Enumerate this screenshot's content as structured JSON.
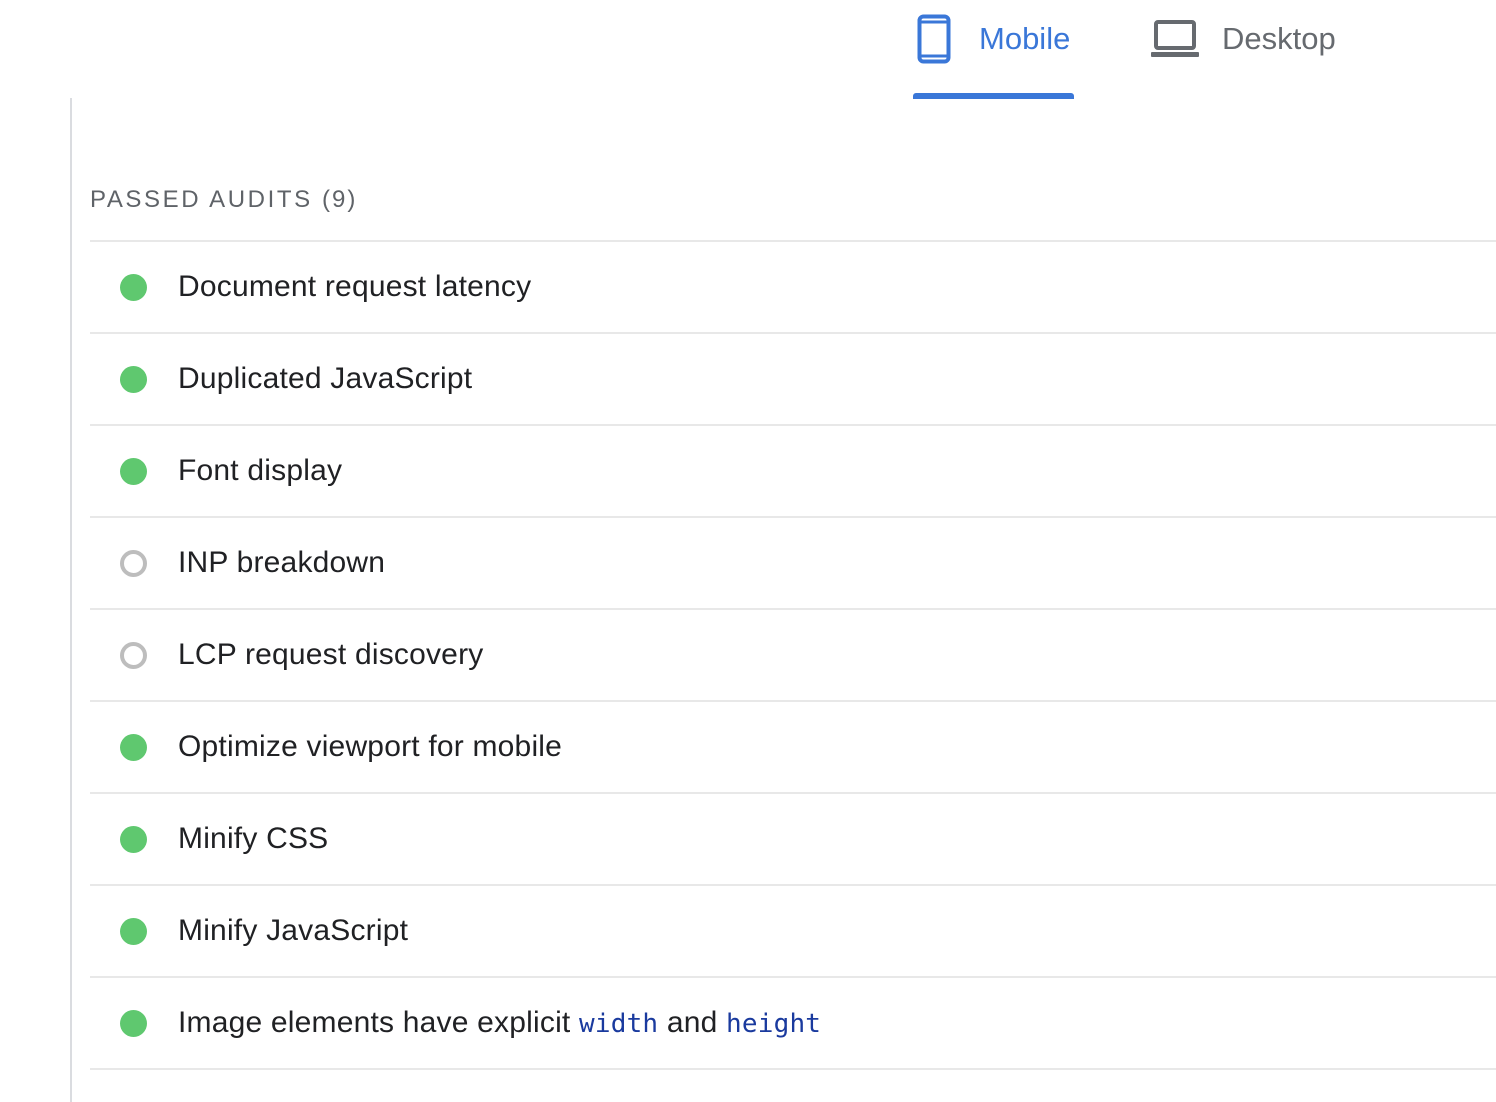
{
  "tabs": {
    "mobile_label": "Mobile",
    "desktop_label": "Desktop",
    "active": "Mobile",
    "accent_color": "#3a77d8"
  },
  "section": {
    "title": "PASSED AUDITS",
    "count": "(9)"
  },
  "audits": [
    {
      "title": "Document request latency",
      "status": "pass"
    },
    {
      "title": "Duplicated JavaScript",
      "status": "pass"
    },
    {
      "title": "Font display",
      "status": "pass"
    },
    {
      "title": "INP breakdown",
      "status": "info"
    },
    {
      "title": "LCP request discovery",
      "status": "info"
    },
    {
      "title": "Optimize viewport for mobile",
      "status": "pass"
    },
    {
      "title": "Minify CSS",
      "status": "pass"
    },
    {
      "title": "Minify JavaScript",
      "status": "pass"
    },
    {
      "title_parts": [
        "Image elements have explicit ",
        "width",
        " and ",
        "height"
      ],
      "status": "pass"
    }
  ],
  "colors": {
    "pass": "#5fc86f",
    "info_outline": "#bdbdbd",
    "code_text": "#1a3a9e"
  },
  "icons": {
    "mobile_tab": "smartphone-icon",
    "desktop_tab": "laptop-icon"
  }
}
